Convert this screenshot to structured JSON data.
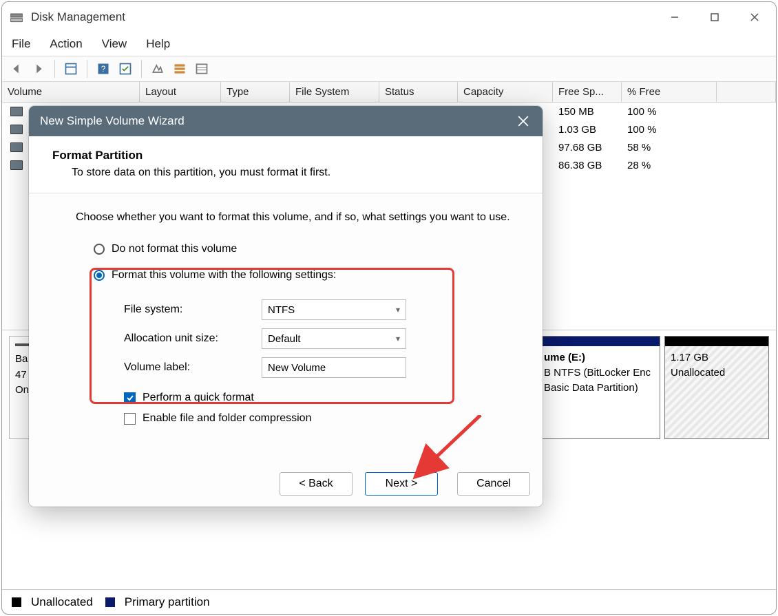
{
  "app": {
    "title": "Disk Management"
  },
  "menu": {
    "file": "File",
    "action": "Action",
    "view": "View",
    "help": "Help"
  },
  "table": {
    "headers": {
      "volume": "Volume",
      "layout": "Layout",
      "type": "Type",
      "fs": "File System",
      "status": "Status",
      "capacity": "Capacity",
      "free": "Free Sp...",
      "pct": "% Free"
    },
    "rows": [
      {
        "free": "150 MB",
        "pct": "100 %"
      },
      {
        "free": "1.03 GB",
        "pct": "100 %"
      },
      {
        "free": "97.68 GB",
        "pct": "58 %"
      },
      {
        "free": "86.38 GB",
        "pct": "28 %"
      }
    ]
  },
  "disk": {
    "label_line1": "Ba",
    "label_line2": "47",
    "label_line3": "On",
    "part1": {
      "title": "ume  (E:)",
      "line2": "B NTFS (BitLocker Enc",
      "line3": "Basic Data Partition)"
    },
    "part2": {
      "line1": "1.17 GB",
      "line2": "Unallocated"
    }
  },
  "legend": {
    "unalloc": "Unallocated",
    "primary": "Primary partition"
  },
  "dialog": {
    "title": "New Simple Volume Wizard",
    "heading": "Format Partition",
    "subheading": "To store data on this partition, you must format it first.",
    "description": "Choose whether you want to format this volume, and if so, what settings you want to use.",
    "opt_noformat": "Do not format this volume",
    "opt_format": "Format this volume with the following settings:",
    "lbl_fs": "File system:",
    "val_fs": "NTFS",
    "lbl_alloc": "Allocation unit size:",
    "val_alloc": "Default",
    "lbl_label": "Volume label:",
    "val_label": "New Volume",
    "chk_quick": "Perform a quick format",
    "chk_compress": "Enable file and folder compression",
    "btn_back": "< Back",
    "btn_next": "Next >",
    "btn_cancel": "Cancel"
  }
}
